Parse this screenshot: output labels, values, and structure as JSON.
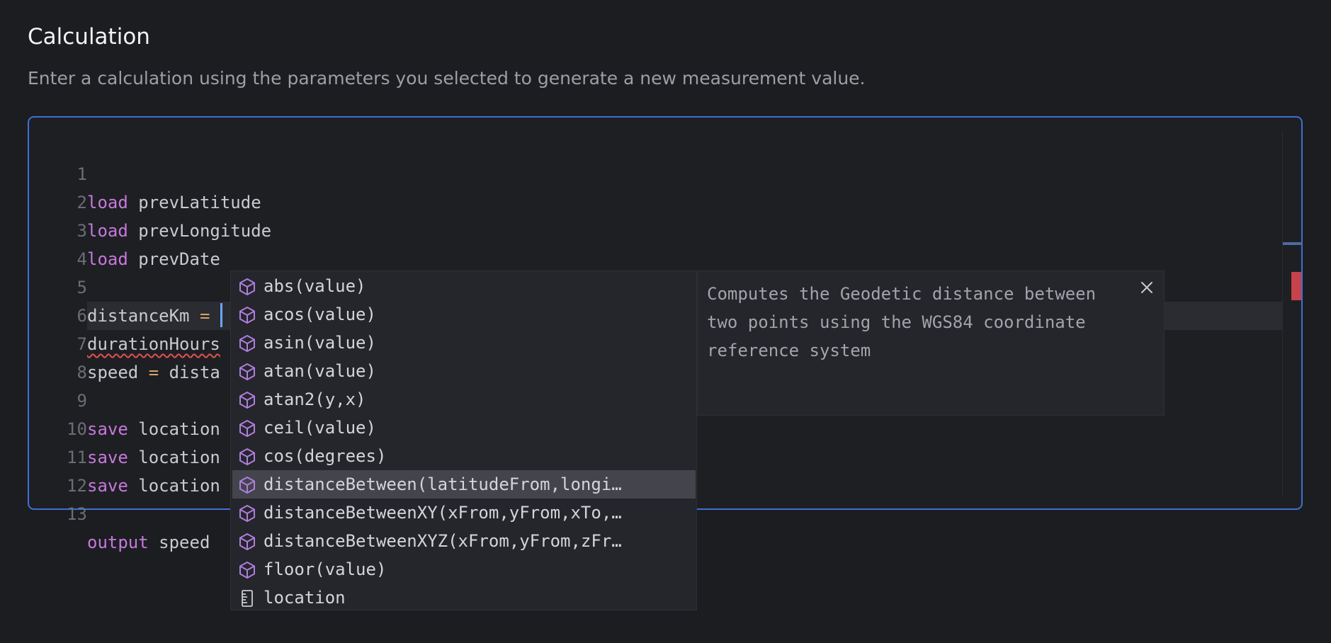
{
  "header": {
    "title": "Calculation",
    "subtitle": "Enter a calculation using the parameters you selected to generate a new measurement value."
  },
  "editor": {
    "lines": [
      {
        "num": "1",
        "kw": "load",
        "rest": " prevLatitude"
      },
      {
        "num": "2",
        "kw": "load",
        "rest": " prevLongitude"
      },
      {
        "num": "3",
        "kw": "load",
        "rest": " prevDate"
      },
      {
        "num": "4",
        "kw": "",
        "rest": ""
      },
      {
        "num": "5",
        "text": "distanceKm",
        "op": " = "
      },
      {
        "num": "6",
        "text": "durationHours"
      },
      {
        "num": "7",
        "text": "speed",
        "op": " = ",
        "rest": "dista"
      },
      {
        "num": "8",
        "kw": "",
        "rest": ""
      },
      {
        "num": "9",
        "kw": "save",
        "rest": " location"
      },
      {
        "num": "10",
        "kw": "save",
        "rest": " location"
      },
      {
        "num": "11",
        "kw": "save",
        "rest": " location"
      },
      {
        "num": "12",
        "kw": "",
        "rest": ""
      },
      {
        "num": "13",
        "kw": "output",
        "rest": " speed"
      }
    ]
  },
  "suggestions": [
    {
      "label": "abs(value)",
      "icon": "cube-icon"
    },
    {
      "label": "acos(value)",
      "icon": "cube-icon"
    },
    {
      "label": "asin(value)",
      "icon": "cube-icon"
    },
    {
      "label": "atan(value)",
      "icon": "cube-icon"
    },
    {
      "label": "atan2(y,x)",
      "icon": "cube-icon"
    },
    {
      "label": "ceil(value)",
      "icon": "cube-icon"
    },
    {
      "label": "cos(degrees)",
      "icon": "cube-icon"
    },
    {
      "label": "distanceBetween(latitudeFrom,longi…",
      "icon": "cube-icon",
      "selected": true
    },
    {
      "label": "distanceBetweenXY(xFrom,yFrom,xTo,…",
      "icon": "cube-icon"
    },
    {
      "label": "distanceBetweenXYZ(xFrom,yFrom,zFr…",
      "icon": "cube-icon"
    },
    {
      "label": "floor(value)",
      "icon": "cube-icon"
    },
    {
      "label": "location",
      "icon": "ruler-icon"
    }
  ],
  "detail": {
    "line1": "Computes the Geodetic distance between",
    "line2": "two points using the WGS84 coordinate",
    "line3": "reference system"
  },
  "colors": {
    "accent": "#3d6fd6",
    "keyword": "#c678dd",
    "operator": "#d6a56a",
    "error": "#c7424b",
    "icon": "#b07de0"
  }
}
